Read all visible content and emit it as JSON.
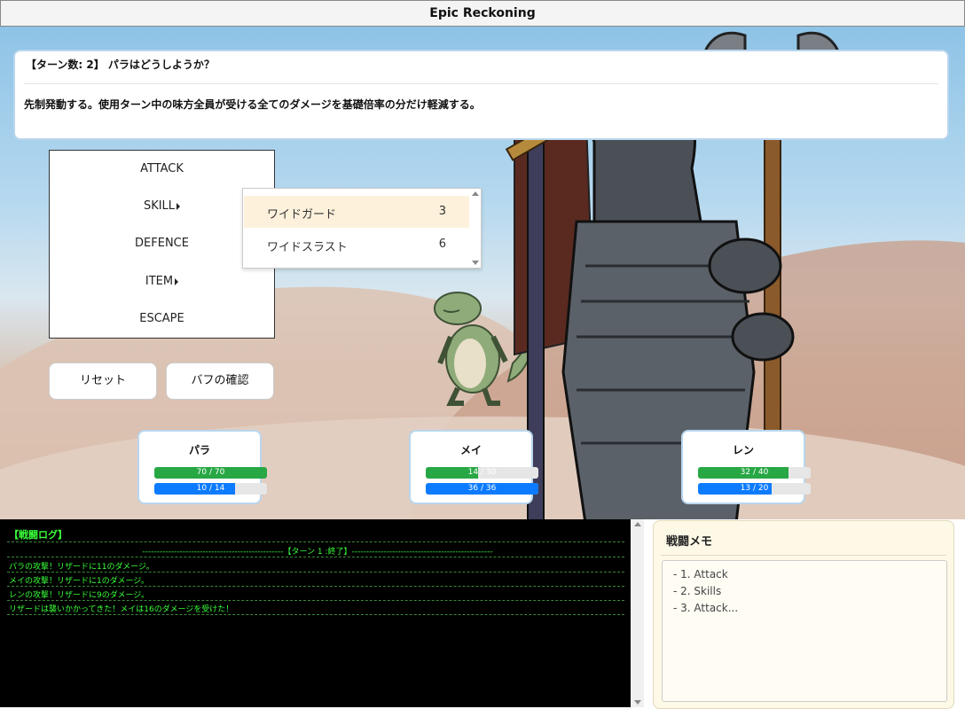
{
  "window": {
    "title": "Epic Reckoning"
  },
  "prompt": {
    "header": "【ターン数: 2】 パラはどうしようか？",
    "description": "先制発動する。使用ターン中の味方全員が受ける全てのダメージを基礎倍率の分だけ軽減する。"
  },
  "command_menu": [
    "ATTACK",
    "SKILL",
    "DEFENCE",
    "ITEM",
    "ESCAPE"
  ],
  "skill_submenu": [
    {
      "name": "ワイドガード",
      "cost": "3"
    },
    {
      "name": "ワイドスラスト",
      "cost": "6"
    }
  ],
  "buttons": {
    "reset": "リセット",
    "buff_check": "バフの確認"
  },
  "party": [
    {
      "name": "パラ",
      "hp": {
        "label": "70 / 70",
        "ratio": 1.0
      },
      "mp": {
        "label": "10 / 14",
        "ratio": 0.714
      }
    },
    {
      "name": "メイ",
      "hp": {
        "label": "14 / 30",
        "ratio": 0.467
      },
      "mp": {
        "label": "36 / 36",
        "ratio": 1.0
      }
    },
    {
      "name": "レン",
      "hp": {
        "label": "32 / 40",
        "ratio": 0.8
      },
      "mp": {
        "label": "13 / 20",
        "ratio": 0.65
      }
    }
  ],
  "battle_log": {
    "title": "【戦闘ログ】",
    "turn_marker": "-------------------------------------------------【ターン 1 :終了】-------------------------------------------------",
    "messages": [
      "パラの攻撃！リザードに11のダメージ。",
      "メイの攻撃！リザードに1のダメージ。",
      "レンの攻撃！リザードに9のダメージ。",
      "リザードは襲いかかってきた！メイは16のダメージを受けた！"
    ]
  },
  "memo": {
    "title": "戦闘メモ",
    "notes": [
      "- 1. Attack",
      "- 2. Skills",
      "- 3. Attack..."
    ]
  },
  "colors": {
    "hp": "#28a745",
    "mp": "#0d7bff",
    "log_text": "#39ff39"
  }
}
